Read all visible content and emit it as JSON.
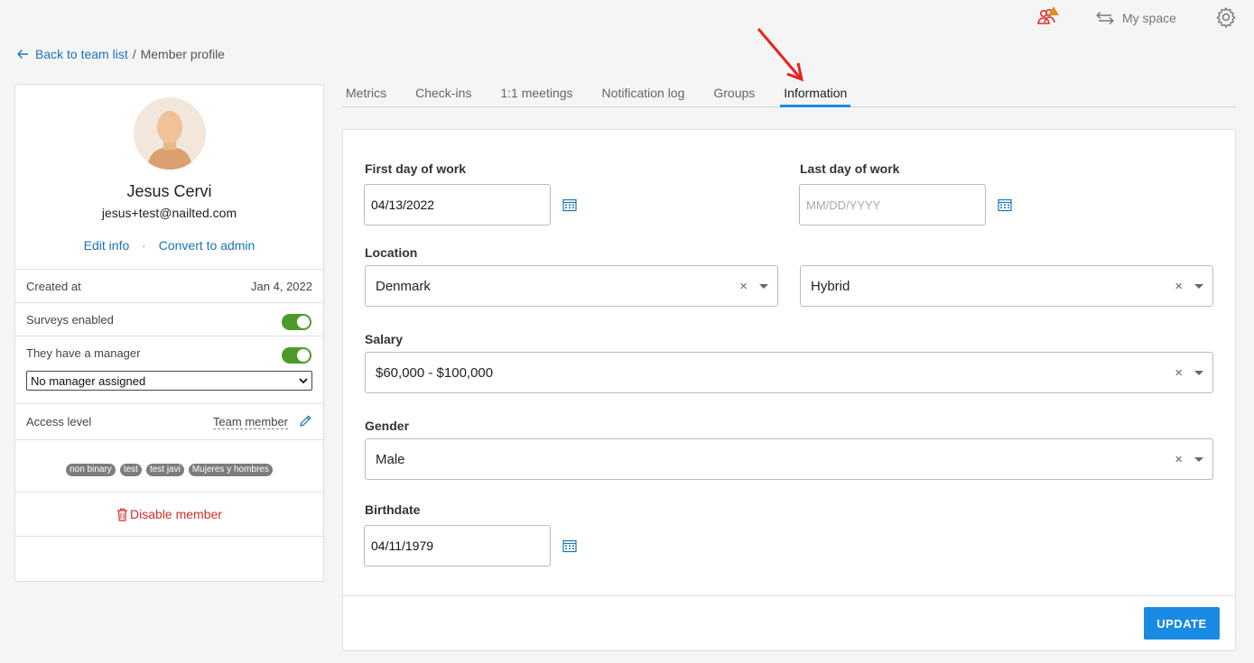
{
  "topbar": {
    "my_space_label": "My space"
  },
  "breadcrumb": {
    "back_label": "Back to team list",
    "separator": "/",
    "current": "Member profile"
  },
  "profile": {
    "name": "Jesus Cervi",
    "email": "jesus+test@nailted.com",
    "edit_label": "Edit info",
    "separator": "·",
    "convert_label": "Convert to admin",
    "created_label": "Created at",
    "created_value": "Jan 4, 2022",
    "surveys_label": "Surveys enabled",
    "surveys_enabled": true,
    "manager_label": "They have a manager",
    "has_manager": true,
    "manager_select_value": "No manager assigned",
    "access_label": "Access level",
    "access_value": "Team member",
    "tags": [
      "non binary",
      "test",
      "test javi",
      "Mujeres y hombres"
    ],
    "disable_label": "Disable member"
  },
  "tabs": [
    {
      "label": "Metrics",
      "active": false
    },
    {
      "label": "Check-ins",
      "active": false
    },
    {
      "label": "1:1 meetings",
      "active": false
    },
    {
      "label": "Notification log",
      "active": false
    },
    {
      "label": "Groups",
      "active": false
    },
    {
      "label": "Information",
      "active": true
    }
  ],
  "form": {
    "first_day_label": "First day of work",
    "first_day_value": "04/13/2022",
    "last_day_label": "Last day of work",
    "last_day_placeholder": "MM/DD/YYYY",
    "location_label": "Location",
    "location_value": "Denmark",
    "work_mode_value": "Hybrid",
    "salary_label": "Salary",
    "salary_value": "$60,000 - $100,000",
    "gender_label": "Gender",
    "gender_value": "Male",
    "birthdate_label": "Birthdate",
    "birthdate_value": "04/11/1979",
    "clear_glyph": "×",
    "update_label": "UPDATE"
  },
  "colors": {
    "accent": "#1a8be3",
    "link": "#1a73b8",
    "toggle_on": "#4d9a2c",
    "danger": "#d82c2c",
    "annotation_arrow": "#e8241c"
  }
}
